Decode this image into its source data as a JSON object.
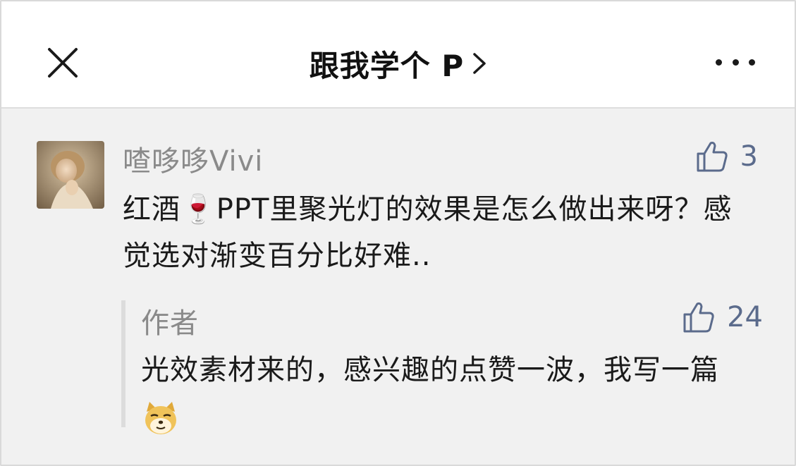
{
  "header": {
    "title": "跟我学个 P",
    "close_icon": "close-icon",
    "chevron_icon": "chevron-right-icon",
    "more_icon": "more-dots-icon"
  },
  "comment": {
    "username": "喳哆哆Vivi",
    "avatar_icon": "user-avatar-photo",
    "likes": "3",
    "text": "红酒🍷PPT里聚光灯的效果是怎么做出来呀？感觉选对渐变百分比好难..",
    "reply": {
      "author": "作者",
      "likes": "24",
      "text": "光效素材来的，感兴趣的点赞一波，我写一篇",
      "emoji_icon": "doge-emoji-icon"
    }
  },
  "colors": {
    "background": "#f1f1f1",
    "header_bg": "#ffffff",
    "like_color": "#5b6b8c",
    "muted_text": "#8a8a8a",
    "body_text": "#1a1a1a"
  }
}
